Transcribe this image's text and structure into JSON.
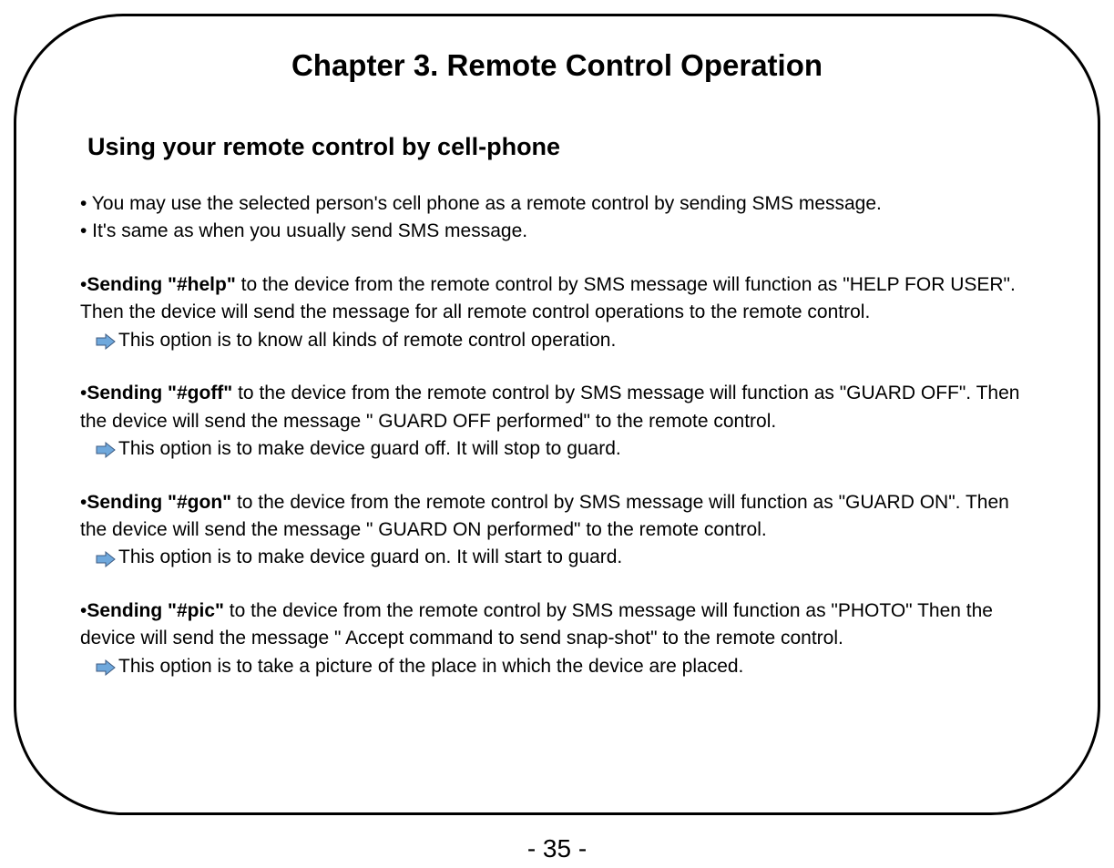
{
  "chapter_title": "Chapter 3. Remote Control Operation",
  "section_title": "Using your remote control by cell-phone",
  "intro": {
    "line1": "• You may use the selected person's cell phone as a remote control by sending SMS message.",
    "line2": "• It's same as when you usually send SMS message."
  },
  "commands": {
    "help": {
      "prefix": "•",
      "bold_label": "Sending \"#help\"",
      "text": " to the device from the remote control by SMS message will function as \"HELP FOR USER\". Then the device will send the message for all remote control operations to the remote control.",
      "arrow_note": "This option is to know all kinds of remote control operation."
    },
    "goff": {
      "prefix": "•",
      "bold_label": "Sending \"#goff\"",
      "text": " to the device from the remote control by SMS message will function as \"GUARD OFF\".  Then the device will send the message \" GUARD OFF performed\" to the remote control.",
      "arrow_note": "This option is to make device guard off. It will stop to guard."
    },
    "gon": {
      "prefix": "•",
      "bold_label": "Sending \"#gon\"",
      "text": " to the device from the remote control by SMS message will function as \"GUARD ON\". Then the device will send the message \" GUARD ON performed\" to the remote control.",
      "arrow_note": "This option is to make device guard on. It will start to guard."
    },
    "pic": {
      "prefix": "•",
      "bold_label": "Sending \"#pic\"",
      "text": " to the device from the remote control by SMS message will function as \"PHOTO\" Then the device will send the message \" Accept command to send snap-shot\" to the remote control.",
      "arrow_note": "This option is to take a picture of the place in which the device are placed."
    }
  },
  "page_number": "- 35 -"
}
